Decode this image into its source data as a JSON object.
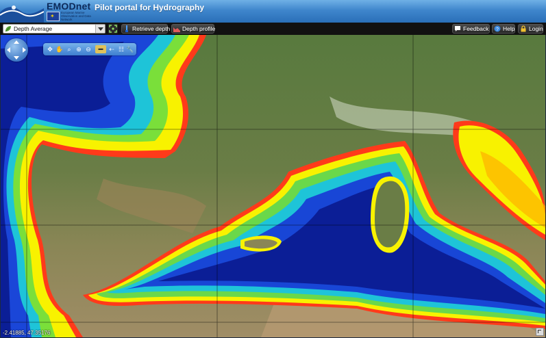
{
  "header": {
    "logo_name": "EMODnet",
    "logo_subtitle": "European Marine Observation and Data Network",
    "portal_title": "Pilot portal for Hydrography"
  },
  "toolbar": {
    "layer_select": {
      "value": "Depth Average"
    },
    "retrieve_depth_label": "Retrieve depth",
    "depth_profile_label": "Depth profile",
    "feedback_label": "Feedback",
    "help_label": "Help",
    "login_label": "Login"
  },
  "map": {
    "coordinates": "-2.41885, 47.35176",
    "tools": [
      "pan-icon",
      "hand-icon",
      "zoom-box-icon",
      "zoom-in-icon",
      "zoom-out-icon",
      "measure-icon",
      "previous-icon",
      "legend-icon",
      "info-icon"
    ]
  },
  "colors": {
    "header_blue": "#3f86cc",
    "toolbar_black": "#111111",
    "deep_sea": "#0a1f9a",
    "shelf_yellow": "#f6f000",
    "coast_red": "#ff2a1a",
    "land_green": "#5f7c3c"
  }
}
